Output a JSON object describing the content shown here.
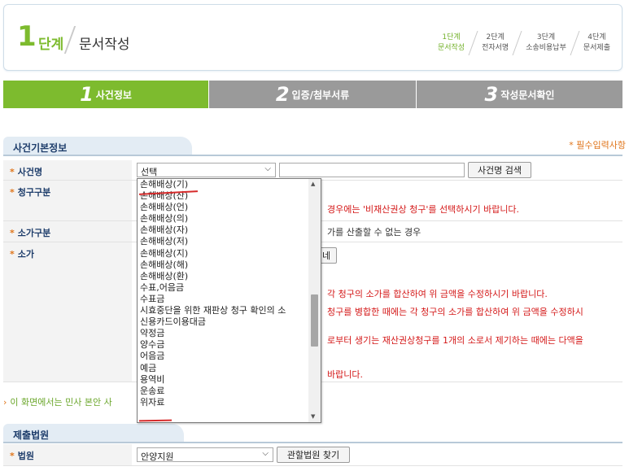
{
  "header": {
    "step_num": "1",
    "step_word": "단계",
    "step_title": "문서작성",
    "mini_steps": [
      {
        "line1": "1단계",
        "line2": "문서작성",
        "active": true
      },
      {
        "line1": "2단계",
        "line2": "전자서명",
        "active": false
      },
      {
        "line1": "3단계",
        "line2": "소송비용납부",
        "active": false
      },
      {
        "line1": "4단계",
        "line2": "문서제출",
        "active": false
      }
    ]
  },
  "tabs": [
    {
      "num": "1",
      "label": "사건정보"
    },
    {
      "num": "2",
      "label": "입증/첨부서류"
    },
    {
      "num": "3",
      "label": "작성문서확인"
    }
  ],
  "section1": {
    "title": "사건기본정보",
    "required_note": "* 필수입력사항"
  },
  "form": {
    "case_name": {
      "label": "사건명",
      "select_value": "선택",
      "search_button": "사건명 검색"
    },
    "claim_type": {
      "label": "청구구분",
      "note_partial": "경우에는 '비재산권상 청구'를 선택하시기 바랍니다."
    },
    "value_type": {
      "label": "소가구분",
      "note_partial": "가를 산출할 수 없는 경우"
    },
    "value": {
      "label": "소가",
      "button_partial": "네",
      "notes": [
        "각 청구의 소가를 합산하여 위 금액을 수정하시기 바랍니다.",
        "청구를 병합한 때에는 각 청구의 소가를 합산하여 위 금액을 수정하시",
        "로부터 생기는 재산권상청구를 1개의 소로서 제기하는 때에는 다액을",
        "바랍니다."
      ]
    }
  },
  "bottom_note": "이 화면에서는 민사 본안 사",
  "section2": {
    "title": "제출법원"
  },
  "court": {
    "label": "법원",
    "select_value": "안양지원",
    "find_button": "관할법원 찾기"
  },
  "dropdown": {
    "items": [
      "손해배상(기)",
      "손해배상(산)",
      "손해배상(언)",
      "손해배상(의)",
      "손해배상(자)",
      "손해배상(저)",
      "손해배상(지)",
      "손해배상(해)",
      "손해배상(환)",
      "수표,어음금",
      "수표금",
      "시효중단을 위한 재판상 청구 확인의 소",
      "신용카드이용대금",
      "약정금",
      "양수금",
      "어음금",
      "예금",
      "용역비",
      "운송료",
      "위자료"
    ]
  },
  "colors": {
    "green": "#7dbb2e",
    "gray_tab": "#9a9a9a",
    "navy": "#1e3d6b",
    "orange": "#e0761c",
    "red": "#d41818"
  }
}
